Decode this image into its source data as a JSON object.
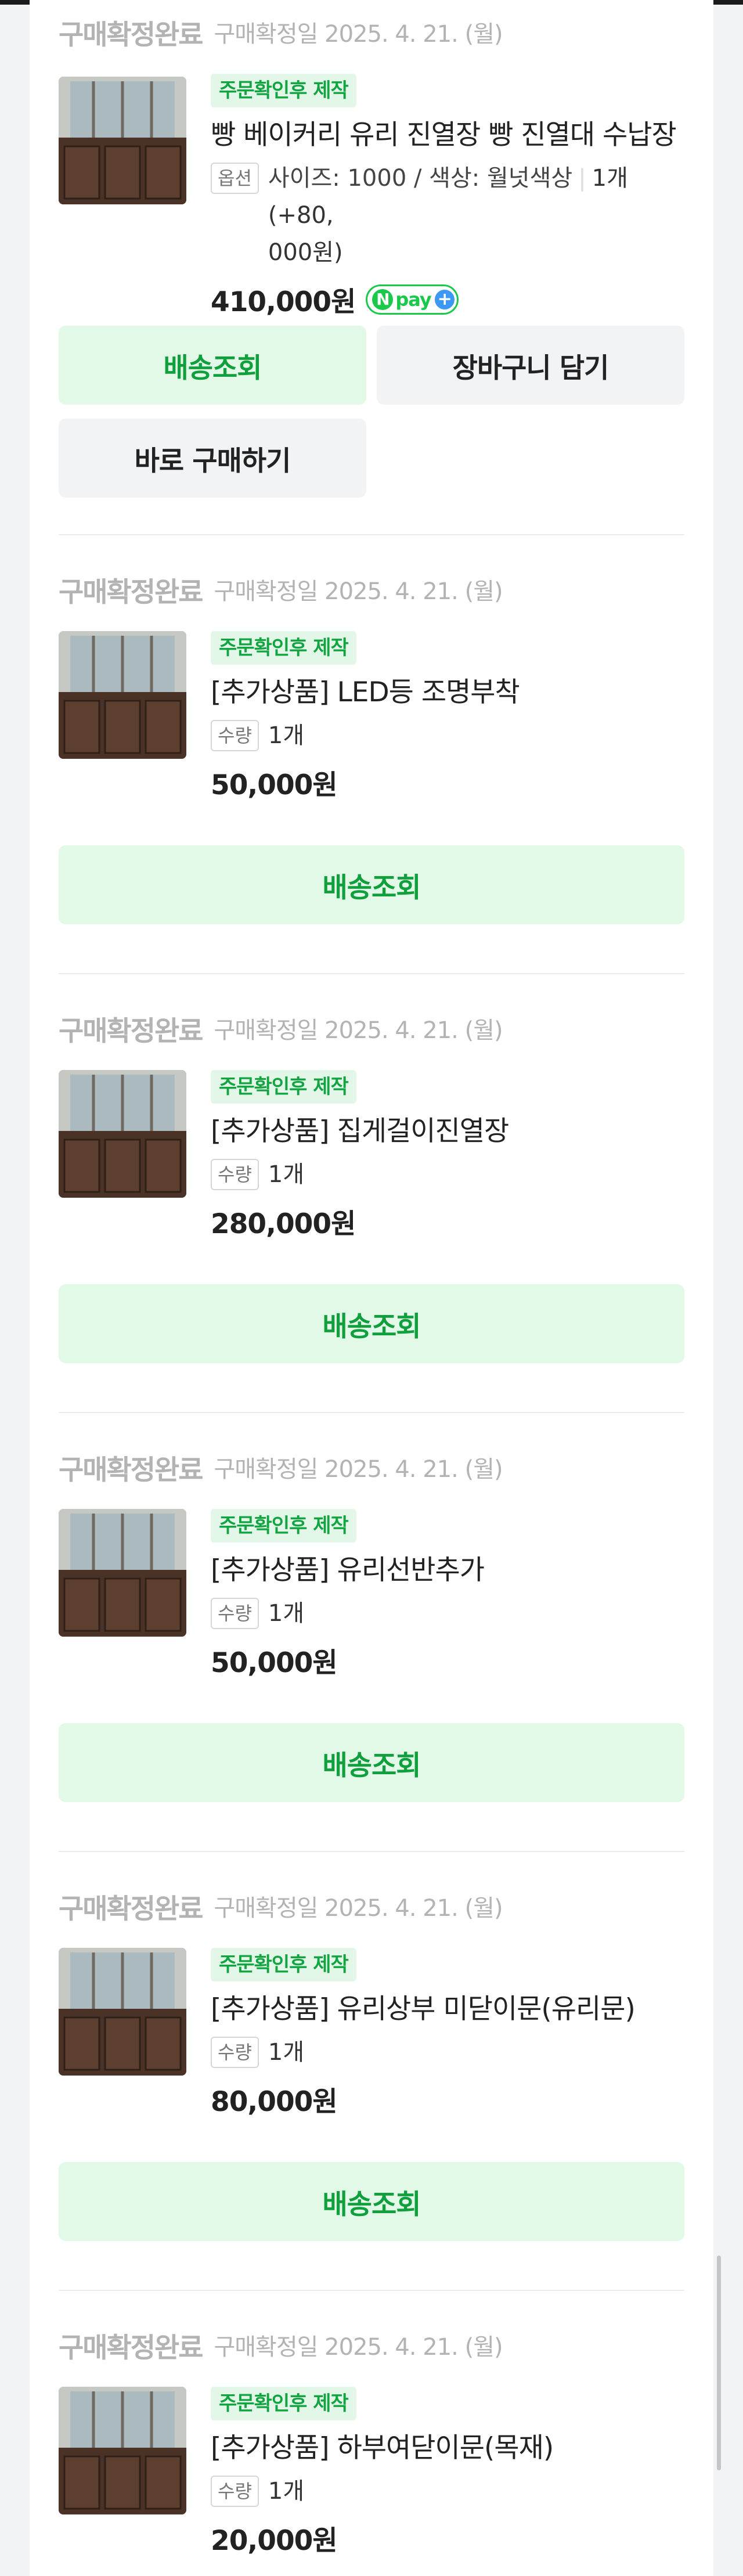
{
  "orders": [
    {
      "status": "구매확정완료",
      "date": "구매확정일 2025. 4. 21. (월)",
      "badge": "주문확인후 제작",
      "name": "빵 베이커리 유리 진열장 빵 진열대 수납장",
      "option_chip": "옵션",
      "option_line1": "사이즈: 1000 / 색상: 월넛색상",
      "qty_line1": "1개 (+80,",
      "option_line2": "000원)",
      "price": "410,000원",
      "npay": "pay",
      "buttons": {
        "track": "배송조회",
        "cart": "장바구니 담기",
        "buy": "바로 구매하기"
      }
    },
    {
      "status": "구매확정완료",
      "date": "구매확정일 2025. 4. 21. (월)",
      "badge": "주문확인후 제작",
      "name": "[추가상품] LED등 조명부착",
      "option_chip": "수량",
      "qty": "1개",
      "price": "50,000원",
      "button": "배송조회"
    },
    {
      "status": "구매확정완료",
      "date": "구매확정일 2025. 4. 21. (월)",
      "badge": "주문확인후 제작",
      "name": "[추가상품] 집게걸이진열장",
      "option_chip": "수량",
      "qty": "1개",
      "price": "280,000원",
      "button": "배송조회"
    },
    {
      "status": "구매확정완료",
      "date": "구매확정일 2025. 4. 21. (월)",
      "badge": "주문확인후 제작",
      "name": "[추가상품] 유리선반추가",
      "option_chip": "수량",
      "qty": "1개",
      "price": "50,000원",
      "button": "배송조회"
    },
    {
      "status": "구매확정완료",
      "date": "구매확정일 2025. 4. 21. (월)",
      "badge": "주문확인후 제작",
      "name": "[추가상품] 유리상부 미닫이문(유리문)",
      "option_chip": "수량",
      "qty": "1개",
      "price": "80,000원",
      "button": "배송조회"
    },
    {
      "status": "구매확정완료",
      "date": "구매확정일 2025. 4. 21. (월)",
      "badge": "주문확인후 제작",
      "name": "[추가상품] 하부여닫이문(목재)",
      "option_chip": "수량",
      "qty": "1개",
      "price": "20,000원"
    }
  ],
  "colors": {
    "accent_green": "#13a442",
    "button_green_bg": "#e1f9e6",
    "badge_bg": "#e3f7e9",
    "status_gray": "#b3b3b3",
    "npay_green": "#19c94a",
    "npay_blue": "#3b98f5"
  },
  "icons": {
    "npay": "npay-logo",
    "thumb": "product-photo-display-cabinet"
  }
}
